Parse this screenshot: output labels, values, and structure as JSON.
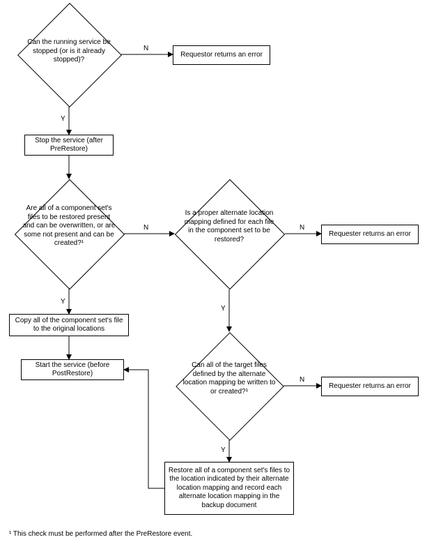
{
  "chart_data": {
    "type": "flowchart",
    "footnote": "¹ This check must be performed after the PreRestore event.",
    "nodes": [
      {
        "id": "d1",
        "type": "decision",
        "text": "Can the running service be stopped (or is it already stopped)?"
      },
      {
        "id": "p1",
        "type": "process",
        "text": "Requestor returns an error"
      },
      {
        "id": "p2",
        "type": "process",
        "text": "Stop the service (after PreRestore)"
      },
      {
        "id": "d2",
        "type": "decision",
        "text": "Are all of a component set's files to be restored present and can be overwritten, or are some not present and can be created?¹"
      },
      {
        "id": "d3",
        "type": "decision",
        "text": "Is a proper alternate location mapping defined for each file in the component set to be restored?"
      },
      {
        "id": "p3",
        "type": "process",
        "text": "Requester returns an error"
      },
      {
        "id": "p4",
        "type": "process",
        "text": "Copy all of the component set's file to the original locations"
      },
      {
        "id": "p5",
        "type": "process",
        "text": "Start the service (before PostRestore)"
      },
      {
        "id": "d4",
        "type": "decision",
        "text": "Can all of the target files defined by the alternate location mapping be written to or created?¹"
      },
      {
        "id": "p6",
        "type": "process",
        "text": "Requester returns an error"
      },
      {
        "id": "p7",
        "type": "process",
        "text": "Restore all of a component set's files to the location indicated by their alternate location mapping and record each alternate location mapping in the backup document"
      }
    ],
    "edges": [
      {
        "from": "d1",
        "to": "p1",
        "label": "N"
      },
      {
        "from": "d1",
        "to": "p2",
        "label": "Y"
      },
      {
        "from": "p2",
        "to": "d2",
        "label": ""
      },
      {
        "from": "d2",
        "to": "d3",
        "label": "N"
      },
      {
        "from": "d2",
        "to": "p4",
        "label": "Y"
      },
      {
        "from": "d3",
        "to": "p3",
        "label": "N"
      },
      {
        "from": "d3",
        "to": "d4",
        "label": "Y"
      },
      {
        "from": "p4",
        "to": "p5",
        "label": ""
      },
      {
        "from": "d4",
        "to": "p6",
        "label": "N"
      },
      {
        "from": "d4",
        "to": "p7",
        "label": "Y"
      },
      {
        "from": "p7",
        "to": "p5",
        "label": ""
      }
    ],
    "labels": {
      "yes": "Y",
      "no": "N"
    }
  }
}
